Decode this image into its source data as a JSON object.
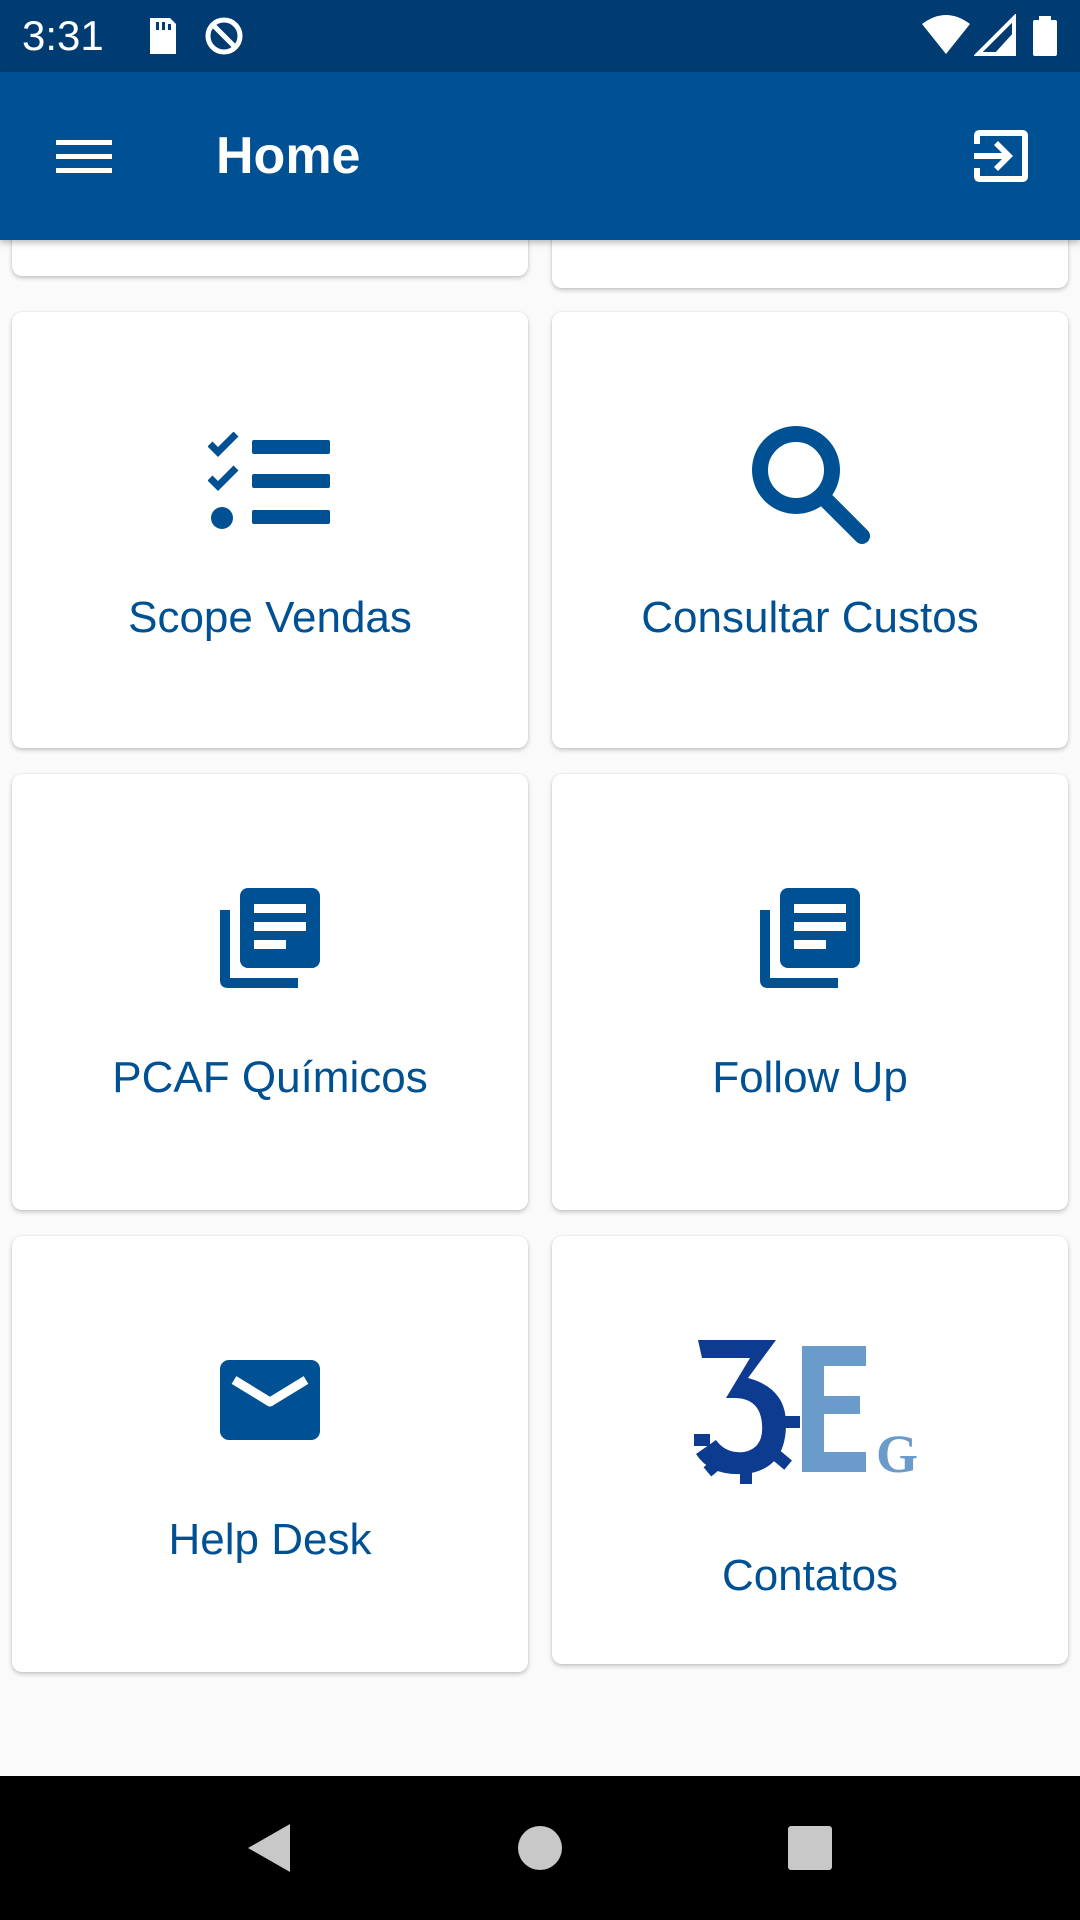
{
  "status_bar": {
    "time": "3:31",
    "icons": [
      "sd-card-icon",
      "data-saver-icon",
      "wifi-icon",
      "signal-icon",
      "battery-icon"
    ]
  },
  "app_bar": {
    "title": "Home",
    "menu_icon": "hamburger-menu-icon",
    "action_icon": "exit-to-app-icon"
  },
  "cards": [
    {
      "label": "Scope Vendas",
      "icon": "checklist-icon"
    },
    {
      "label": "Consultar Custos",
      "icon": "search-icon"
    },
    {
      "label": "PCAF Químicos",
      "icon": "library-books-icon"
    },
    {
      "label": "Follow Up",
      "icon": "library-books-icon"
    },
    {
      "label": "Help Desk",
      "icon": "mail-icon"
    },
    {
      "label": "Contatos",
      "icon": "3eg-logo"
    }
  ],
  "logo": {
    "text": "3EG"
  },
  "nav_bar": {
    "buttons": [
      "back-icon",
      "home-icon",
      "recents-icon"
    ]
  },
  "colors": {
    "status_bar": "#003c71",
    "app_bar": "#005193",
    "accent": "#005193",
    "background": "#fafafa",
    "logo_dark": "#0d3b8f",
    "logo_light": "#6b9bcb"
  }
}
